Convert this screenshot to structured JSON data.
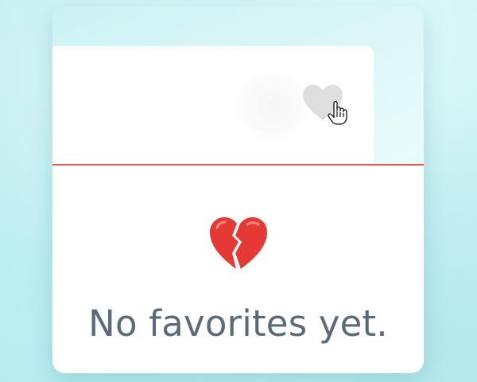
{
  "favorites_panel": {
    "item_card": {
      "favorite_toggle_icon": "heart-icon",
      "favorite_toggle_color": "#dcdcdc"
    },
    "divider_color": "#e8584a",
    "empty_state": {
      "icon": "broken-heart-icon",
      "icon_color": "#e53935",
      "message": "No favorites yet.",
      "message_color": "#5a6b78"
    }
  },
  "pointer": {
    "icon": "hand-pointer-icon"
  }
}
